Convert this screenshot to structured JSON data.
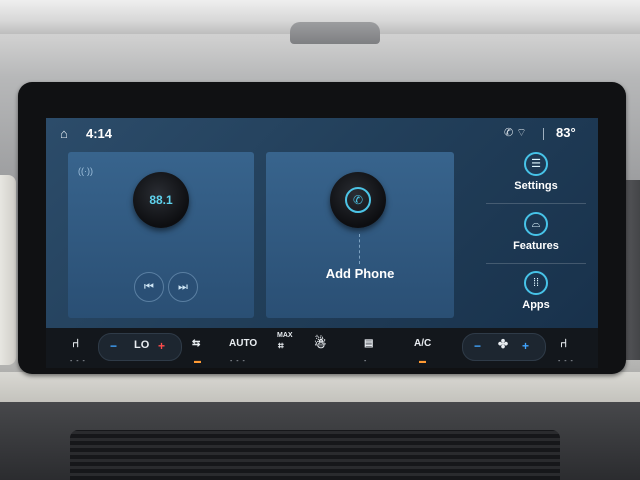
{
  "status_bar": {
    "home_icon": "home-icon",
    "time": "4:14",
    "indicators": [
      "phone-off-icon",
      "wifi-icon"
    ],
    "temperature": "83°"
  },
  "radio_tile": {
    "frequency": "88.1",
    "signal_icon": "radio-signal-icon",
    "prev_icon": "seek-back-icon",
    "next_icon": "seek-forward-icon",
    "prev_glyph": "⏮",
    "next_glyph": "⏭"
  },
  "phone_tile": {
    "icon": "phone-icon",
    "label": "Add Phone"
  },
  "menu": [
    {
      "label": "Settings",
      "icon": "settings-sliders-icon"
    },
    {
      "label": "Features",
      "icon": "car-features-icon"
    },
    {
      "label": "Apps",
      "icon": "apps-grid-icon"
    }
  ],
  "climate": {
    "driver_seat_icon": "driver-seat-icon",
    "minus": "−",
    "plus": "+",
    "temp_label": "LO",
    "recirc_icon": "recirculation-icon",
    "auto_label": "AUTO",
    "max_label": "MAX",
    "max_defrost_icon": "max-defrost-icon",
    "climate_icon": "climate-person-icon",
    "rear_defrost_icon": "rear-defrost-icon",
    "ac_label": "A/C",
    "fan_icon": "fan-icon",
    "passenger_seat_icon": "passenger-seat-icon",
    "indicator": "- - -"
  }
}
